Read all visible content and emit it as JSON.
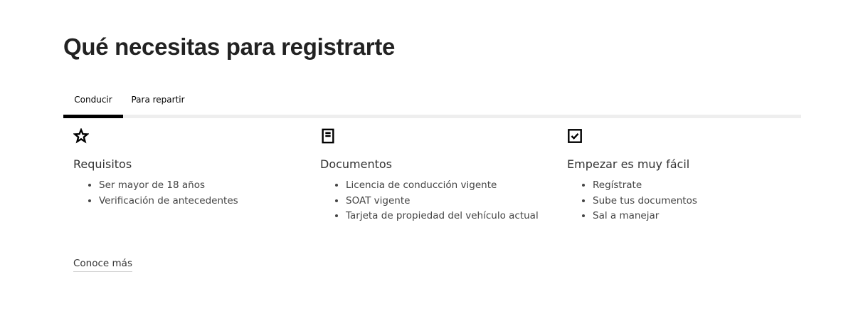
{
  "page": {
    "title": "Qué necesitas para registrarte"
  },
  "tabs": [
    {
      "label": "Conducir",
      "active": true
    },
    {
      "label": "Para repartir",
      "active": false
    }
  ],
  "columns": [
    {
      "icon": "star-icon",
      "title": "Requisitos",
      "items": [
        "Ser mayor de 18 años",
        "Verificación de antecedentes"
      ]
    },
    {
      "icon": "document-icon",
      "title": "Documentos",
      "items": [
        "Licencia de conducción vigente",
        "SOAT vigente",
        "Tarjeta de propiedad del vehículo actual"
      ]
    },
    {
      "icon": "checkbox-icon",
      "title": "Empezar es muy fácil",
      "items": [
        "Regístrate",
        "Sube tus documentos",
        "Sal a manejar"
      ]
    }
  ],
  "link": {
    "more_label": "Conoce más"
  },
  "colors": {
    "text": "#333333",
    "active_tab": "#000000",
    "tab_rule": "#eeeeee"
  }
}
